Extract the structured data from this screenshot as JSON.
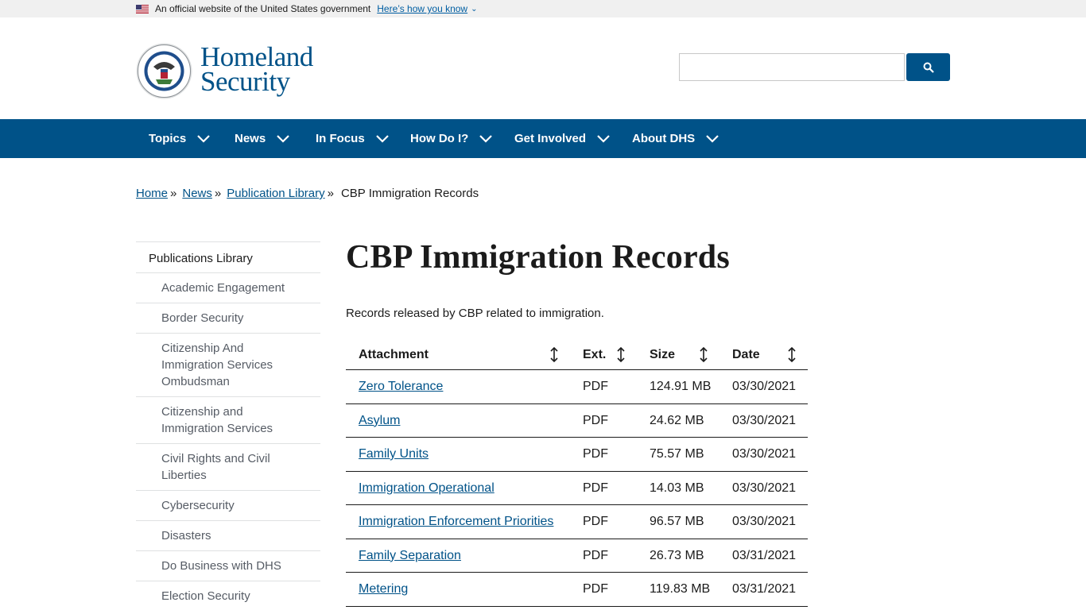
{
  "gov_banner": {
    "text": "An official website of the United States government",
    "link": "Here’s how you know"
  },
  "header": {
    "wordmark_line1": "Homeland",
    "wordmark_line2": "Security",
    "search_placeholder": "",
    "brand_color": "#005288"
  },
  "nav": {
    "items": [
      {
        "label": "Topics"
      },
      {
        "label": "News"
      },
      {
        "label": "In Focus"
      },
      {
        "label": "How Do I?"
      },
      {
        "label": "Get Involved"
      },
      {
        "label": "About DHS"
      }
    ]
  },
  "breadcrumb": {
    "items": [
      "Home",
      "News",
      "Publication Library"
    ],
    "separator": "»",
    "current": "CBP Immigration Records"
  },
  "sidebar": {
    "title": "Publications Library",
    "items": [
      "Academic Engagement",
      "Border Security",
      "Citizenship And Immigration Services Ombudsman",
      "Citizenship and Immigration Services",
      "Civil Rights and Civil Liberties",
      "Cybersecurity",
      "Disasters",
      "Do Business with DHS",
      "Election Security"
    ]
  },
  "main": {
    "title": "CBP Immigration Records",
    "intro": "Records released by CBP related to immigration."
  },
  "table": {
    "headers": [
      "Attachment",
      "Ext.",
      "Size",
      "Date"
    ],
    "rows": [
      {
        "name": "Zero Tolerance",
        "ext": "PDF",
        "size": "124.91 MB",
        "date": "03/30/2021"
      },
      {
        "name": "Asylum",
        "ext": "PDF",
        "size": "24.62 MB",
        "date": "03/30/2021"
      },
      {
        "name": "Family Units",
        "ext": "PDF",
        "size": "75.57 MB",
        "date": "03/30/2021"
      },
      {
        "name": "Immigration Operational",
        "ext": "PDF",
        "size": "14.03 MB",
        "date": "03/30/2021"
      },
      {
        "name": "Immigration Enforcement Priorities",
        "ext": "PDF",
        "size": "96.57 MB",
        "date": "03/30/2021"
      },
      {
        "name": "Family Separation",
        "ext": "PDF",
        "size": "26.73 MB",
        "date": "03/31/2021"
      },
      {
        "name": "Metering",
        "ext": "PDF",
        "size": "119.83 MB",
        "date": "03/31/2021"
      }
    ]
  }
}
